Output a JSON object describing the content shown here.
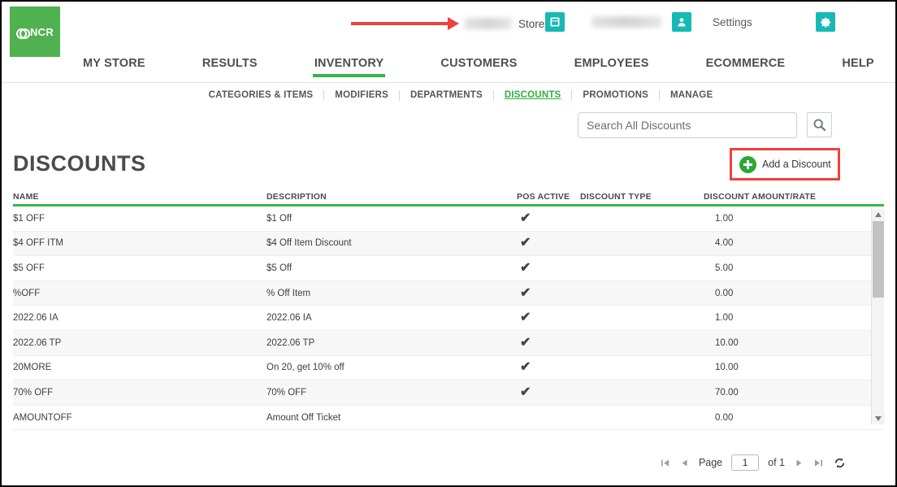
{
  "header": {
    "logo_text": "NCR",
    "store_label": "Store",
    "settings_label": "Settings",
    "store_icon": "store-icon",
    "user_icon": "user-icon",
    "gear_icon": "gear-icon",
    "annotation_arrow": "red-arrow-annotation"
  },
  "main_nav": [
    {
      "label": "MY STORE",
      "active": false
    },
    {
      "label": "RESULTS",
      "active": false
    },
    {
      "label": "INVENTORY",
      "active": true
    },
    {
      "label": "CUSTOMERS",
      "active": false
    },
    {
      "label": "EMPLOYEES",
      "active": false
    },
    {
      "label": "ECOMMERCE",
      "active": false
    },
    {
      "label": "HELP",
      "active": false
    }
  ],
  "sub_nav": [
    {
      "label": "CATEGORIES & ITEMS",
      "active": false
    },
    {
      "label": "MODIFIERS",
      "active": false
    },
    {
      "label": "DEPARTMENTS",
      "active": false
    },
    {
      "label": "DISCOUNTS",
      "active": true
    },
    {
      "label": "PROMOTIONS",
      "active": false
    },
    {
      "label": "MANAGE",
      "active": false
    }
  ],
  "search": {
    "placeholder": "Search All Discounts",
    "value": "",
    "button_icon": "search-icon"
  },
  "page": {
    "title": "DISCOUNTS",
    "add_button_label": "Add a Discount",
    "add_button_icon": "plus-circle-icon"
  },
  "table": {
    "columns": [
      "NAME",
      "DESCRIPTION",
      "POS ACTIVE",
      "DISCOUNT TYPE",
      "DISCOUNT AMOUNT/RATE"
    ],
    "rows": [
      {
        "name": "$1 OFF",
        "description": "$1 Off",
        "pos_active": "✔",
        "discount_type": "",
        "amount": "1.00"
      },
      {
        "name": "$4 OFF ITM",
        "description": "$4 Off Item Discount",
        "pos_active": "✔",
        "discount_type": "",
        "amount": "4.00"
      },
      {
        "name": "$5 OFF",
        "description": "$5 Off",
        "pos_active": "✔",
        "discount_type": "",
        "amount": "5.00"
      },
      {
        "name": "%OFF",
        "description": "% Off Item",
        "pos_active": "✔",
        "discount_type": "",
        "amount": "0.00"
      },
      {
        "name": "2022.06 IA",
        "description": "2022.06 IA",
        "pos_active": "✔",
        "discount_type": "",
        "amount": "1.00"
      },
      {
        "name": "2022.06 TP",
        "description": "2022.06 TP",
        "pos_active": "✔",
        "discount_type": "",
        "amount": "10.00"
      },
      {
        "name": "20MORE",
        "description": "On 20, get 10% off",
        "pos_active": "✔",
        "discount_type": "",
        "amount": "10.00"
      },
      {
        "name": "70% OFF",
        "description": "70% OFF",
        "pos_active": "✔",
        "discount_type": "",
        "amount": "70.00"
      },
      {
        "name": "AMOUNTOFF",
        "description": "Amount Off Ticket",
        "pos_active": "",
        "discount_type": "",
        "amount": "0.00"
      }
    ]
  },
  "pagination": {
    "first_icon": "first-page-icon",
    "prev_icon": "prev-page-icon",
    "page_label": "Page",
    "page_value": "1",
    "of_label": "of 1",
    "next_icon": "next-page-icon",
    "last_icon": "last-page-icon",
    "refresh_icon": "refresh-icon"
  },
  "colors": {
    "brand_green": "#4fb14f",
    "accent_green": "#37b34a",
    "teal": "#17b9b4",
    "annotation_red": "#f0403a"
  }
}
